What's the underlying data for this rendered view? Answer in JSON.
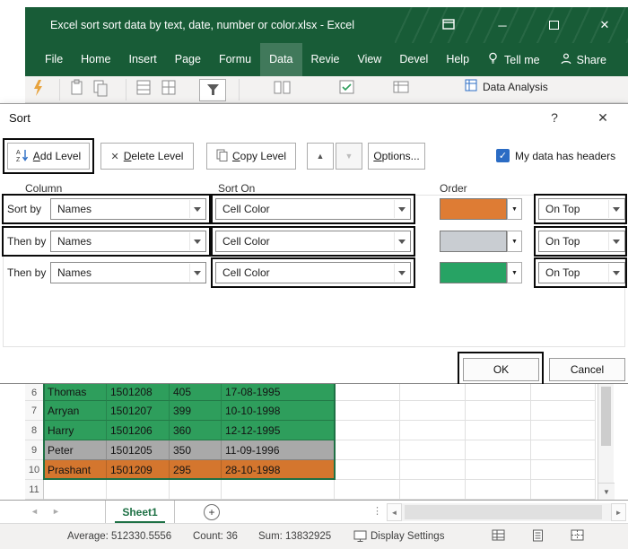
{
  "colors": {
    "excel_green_dark": "#185C37",
    "excel_green_accent": "#1E7145",
    "checkbox_blue": "#2B6CC4"
  },
  "titlebar": {
    "title": "Excel sort sort data by text, date, number or color.xlsx  -  Excel",
    "minimize_glyph": "─",
    "close_glyph": "✕"
  },
  "ribbon": {
    "tabs": [
      "File",
      "Home",
      "Insert",
      "Page",
      "Formu",
      "Data",
      "Revie",
      "View",
      "Devel",
      "Help"
    ],
    "active_tab": "Data",
    "tell_me": "Tell me",
    "share": "Share",
    "data_analysis": "Data Analysis"
  },
  "dialog": {
    "title": "Sort",
    "help_glyph": "?",
    "close_glyph": "✕",
    "add_level": "Add Level",
    "delete_level": "Delete Level",
    "delete_x_glyph": "✕",
    "copy_level": "Copy Level",
    "up_glyph": "▲",
    "down_glyph": "▼",
    "options": "Options...",
    "check_glyph": "✓",
    "my_data_has_headers": "My data has headers",
    "col_header": "Column",
    "sorton_header": "Sort On",
    "order_header": "Order",
    "levels": [
      {
        "label": "Sort by",
        "column": "Names",
        "sort_on": "Cell Color",
        "swatch": "#DE7C34",
        "order": "On Top"
      },
      {
        "label": "Then by",
        "column": "Names",
        "sort_on": "Cell Color",
        "swatch": "#C9CDD2",
        "order": "On Top"
      },
      {
        "label": "Then by",
        "column": "Names",
        "sort_on": "Cell Color",
        "swatch": "#27A364",
        "order": "On Top"
      }
    ],
    "ok": "OK",
    "cancel": "Cancel"
  },
  "sheet": {
    "rows": [
      {
        "num": "6",
        "name": "Thomas",
        "id": "1501208",
        "value": "405",
        "date": "17-08-1995",
        "bg": "#2E9E5C"
      },
      {
        "num": "7",
        "name": "Arryan",
        "id": "1501207",
        "value": "399",
        "date": "10-10-1998",
        "bg": "#2E9E5C"
      },
      {
        "num": "8",
        "name": "Harry",
        "id": "1501206",
        "value": "360",
        "date": "12-12-1995",
        "bg": "#2E9E5C"
      },
      {
        "num": "9",
        "name": "Peter",
        "id": "1501205",
        "value": "350",
        "date": "11-09-1996",
        "bg": "#A9A9A9"
      },
      {
        "num": "10",
        "name": "Prashant",
        "id": "1501209",
        "value": "295",
        "date": "28-10-1998",
        "bg": "#D4762E"
      },
      {
        "num": "11",
        "name": "",
        "id": "",
        "value": "",
        "date": "",
        "bg": "#FFFFFF"
      }
    ],
    "tab": "Sheet1",
    "plus_glyph": "+",
    "nav_left_glyph": "◄",
    "nav_right_glyph": "►",
    "dots_glyph": "⋮",
    "scroll_down_glyph": "▼"
  },
  "status": {
    "average": "Average: 512330.5556",
    "count": "Count: 36",
    "sum": "Sum: 13832925",
    "display_settings": "Display Settings"
  }
}
